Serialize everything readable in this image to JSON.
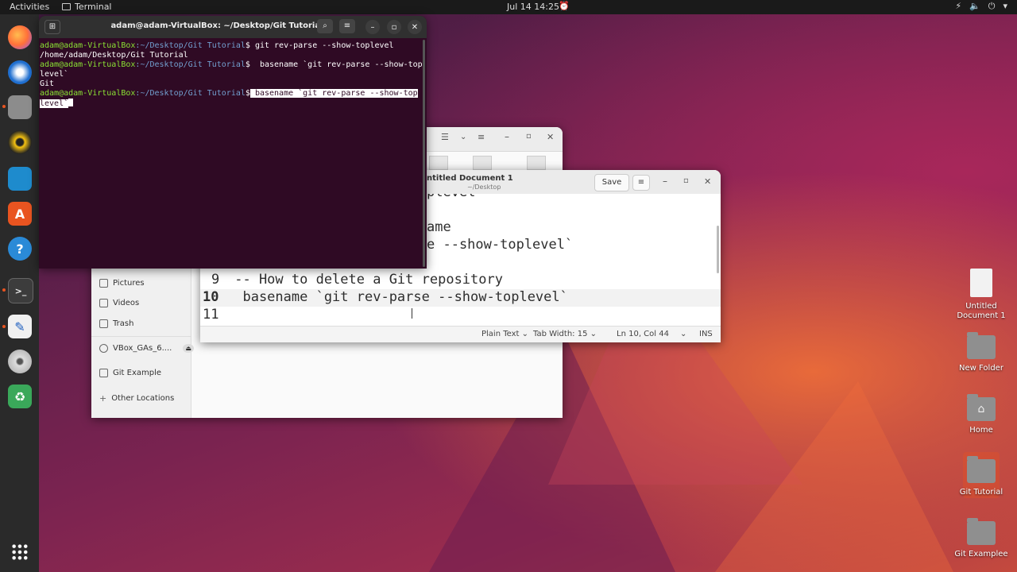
{
  "topbar": {
    "activities": "Activities",
    "app_name": "Terminal",
    "clock": "Jul 14  14:25"
  },
  "terminal": {
    "title": "adam@adam-VirtualBox: ~/Desktop/Git Tutorial",
    "prompt_user": "adam@adam-VirtualBox",
    "prompt_path": ":~/Desktop/Git Tutorial",
    "prompt_symbol": "$",
    "cmd1": " git rev-parse --show-toplevel",
    "out1": "/home/adam/Desktop/Git Tutorial",
    "cmd2_a": "  basename `git rev-parse --show-top",
    "cmd2_b": "level`",
    "out2": "Git",
    "cmd3_a": " basename `git rev-parse --show-top",
    "cmd3_b": "level`"
  },
  "files": {
    "sidebar": [
      {
        "label": "Pictures",
        "icon": "pictures-icon"
      },
      {
        "label": "Videos",
        "icon": "videos-icon"
      },
      {
        "label": "Trash",
        "icon": "trash-icon"
      },
      {
        "label": "VBox_GAs_6....",
        "icon": "drive-icon"
      },
      {
        "label": "Git Example",
        "icon": "folder-icon"
      },
      {
        "label": "Other Locations",
        "icon": "plus-icon"
      }
    ]
  },
  "editor": {
    "title": "ntitled Document 1",
    "subtitle": "~/Desktop",
    "save_label": "Save",
    "lines": [
      {
        "num": "",
        "text": "plevel`"
      },
      {
        "num": "",
        "text": "ame"
      },
      {
        "num": "",
        "text": "e --show-toplevel`"
      },
      {
        "num": "9",
        "text": " -- How to delete a Git repository"
      },
      {
        "num": "10",
        "text": "  basename `git rev-parse --show-toplevel`"
      },
      {
        "num": "11",
        "text": ""
      }
    ],
    "status": {
      "syntax": "Plain Text",
      "tab_width": "Tab Width: 15",
      "position": "Ln 10, Col 44",
      "mode": "INS"
    }
  },
  "desktop": {
    "icons": [
      {
        "label": "Untitled Document 1",
        "icon": "document-icon"
      },
      {
        "label": "New Folder",
        "icon": "folder-icon"
      },
      {
        "label": "Home",
        "icon": "home-icon"
      },
      {
        "label": "Git Tutorial",
        "icon": "folder-icon"
      },
      {
        "label": "Git Examplee",
        "icon": "folder-icon"
      }
    ]
  },
  "colors": {
    "terminal_bg": "#2f0a24",
    "prompt_user": "#8ae234",
    "prompt_path": "#729fcf",
    "accent": "#e95420"
  }
}
